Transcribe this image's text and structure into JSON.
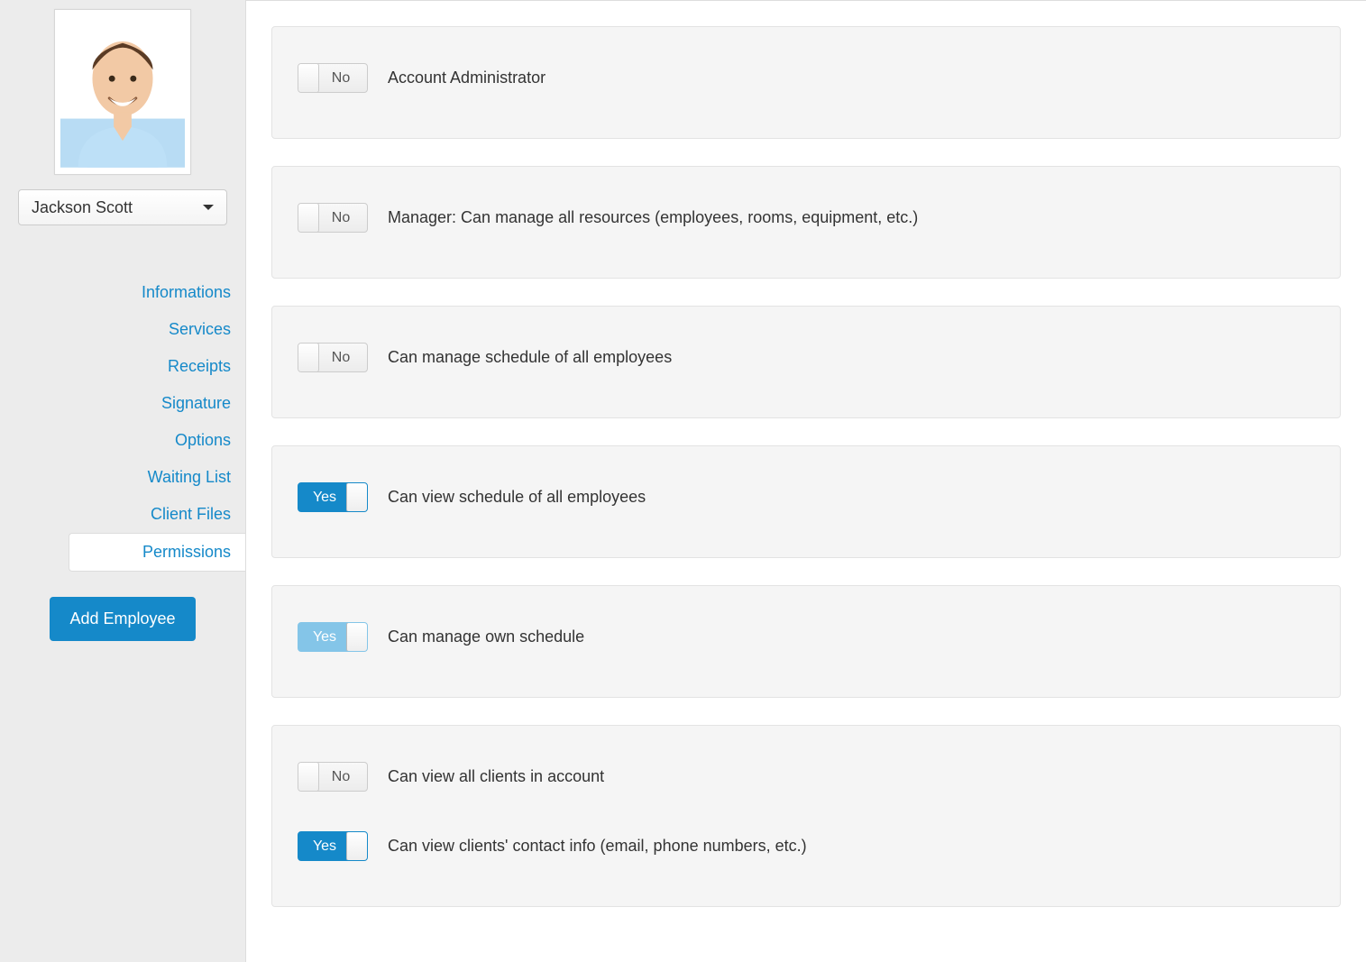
{
  "sidebar": {
    "employee_name": "Jackson Scott",
    "nav": [
      {
        "label": "Informations",
        "active": false
      },
      {
        "label": "Services",
        "active": false
      },
      {
        "label": "Receipts",
        "active": false
      },
      {
        "label": "Signature",
        "active": false
      },
      {
        "label": "Options",
        "active": false
      },
      {
        "label": "Waiting List",
        "active": false
      },
      {
        "label": "Client Files",
        "active": false
      },
      {
        "label": "Permissions",
        "active": true
      }
    ],
    "add_employee_label": "Add Employee"
  },
  "toggle_labels": {
    "on": "Yes",
    "off": "No"
  },
  "perm_groups": [
    {
      "items": [
        {
          "label": "Account Administrator",
          "value": false,
          "disabled": false
        }
      ]
    },
    {
      "items": [
        {
          "label": "Manager: Can manage all resources (employees, rooms, equipment, etc.)",
          "value": false,
          "disabled": false
        }
      ]
    },
    {
      "items": [
        {
          "label": "Can manage schedule of all employees",
          "value": false,
          "disabled": false
        }
      ]
    },
    {
      "items": [
        {
          "label": "Can view schedule of all employees",
          "value": true,
          "disabled": false
        }
      ]
    },
    {
      "items": [
        {
          "label": "Can manage own schedule",
          "value": true,
          "disabled": true
        }
      ]
    },
    {
      "items": [
        {
          "label": "Can view all clients in account",
          "value": false,
          "disabled": false
        },
        {
          "label": "Can view clients' contact info (email, phone numbers, etc.)",
          "value": true,
          "disabled": false
        }
      ]
    }
  ]
}
